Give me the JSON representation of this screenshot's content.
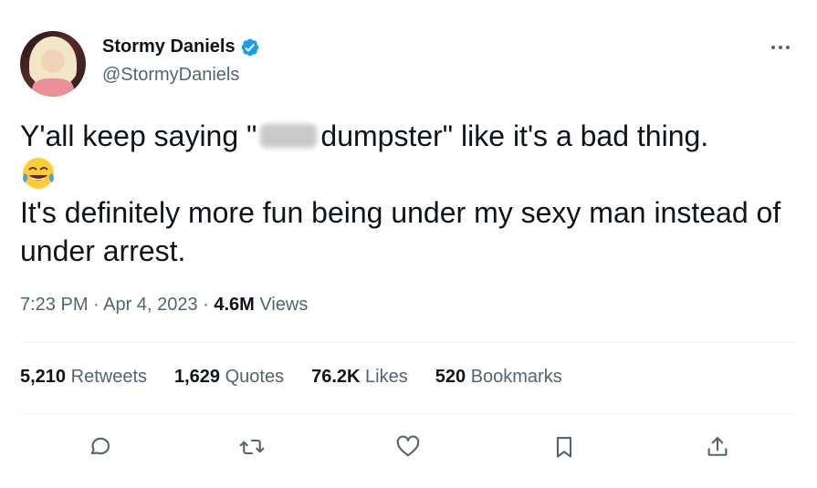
{
  "author": {
    "name": "Stormy Daniels",
    "handle": "@StormyDaniels",
    "verified": true
  },
  "icons": {
    "verified": "verified-badge-icon",
    "more": "more-icon",
    "reply": "reply-icon",
    "retweet": "retweet-icon",
    "like": "heart-icon",
    "bookmark": "bookmark-icon",
    "share": "share-icon",
    "emoji": "tears-of-joy-emoji"
  },
  "tweet": {
    "line1_before": "Y'all keep saying \"",
    "line1_after": "dumpster\" like it's a bad thing.",
    "line2": "It's definitely more fun being under my sexy man instead of under arrest."
  },
  "meta": {
    "time": "7:23 PM",
    "separator": " · ",
    "date": "Apr 4, 2023",
    "views_count": "4.6M",
    "views_label": "Views"
  },
  "stats": [
    {
      "count": "5,210",
      "label": "Retweets"
    },
    {
      "count": "1,629",
      "label": "Quotes"
    },
    {
      "count": "76.2K",
      "label": "Likes"
    },
    {
      "count": "520",
      "label": "Bookmarks"
    }
  ],
  "colors": {
    "verified": "#1d9bf0",
    "text": "#0f1419",
    "secondary": "#536471",
    "divider": "#eff3f4"
  }
}
